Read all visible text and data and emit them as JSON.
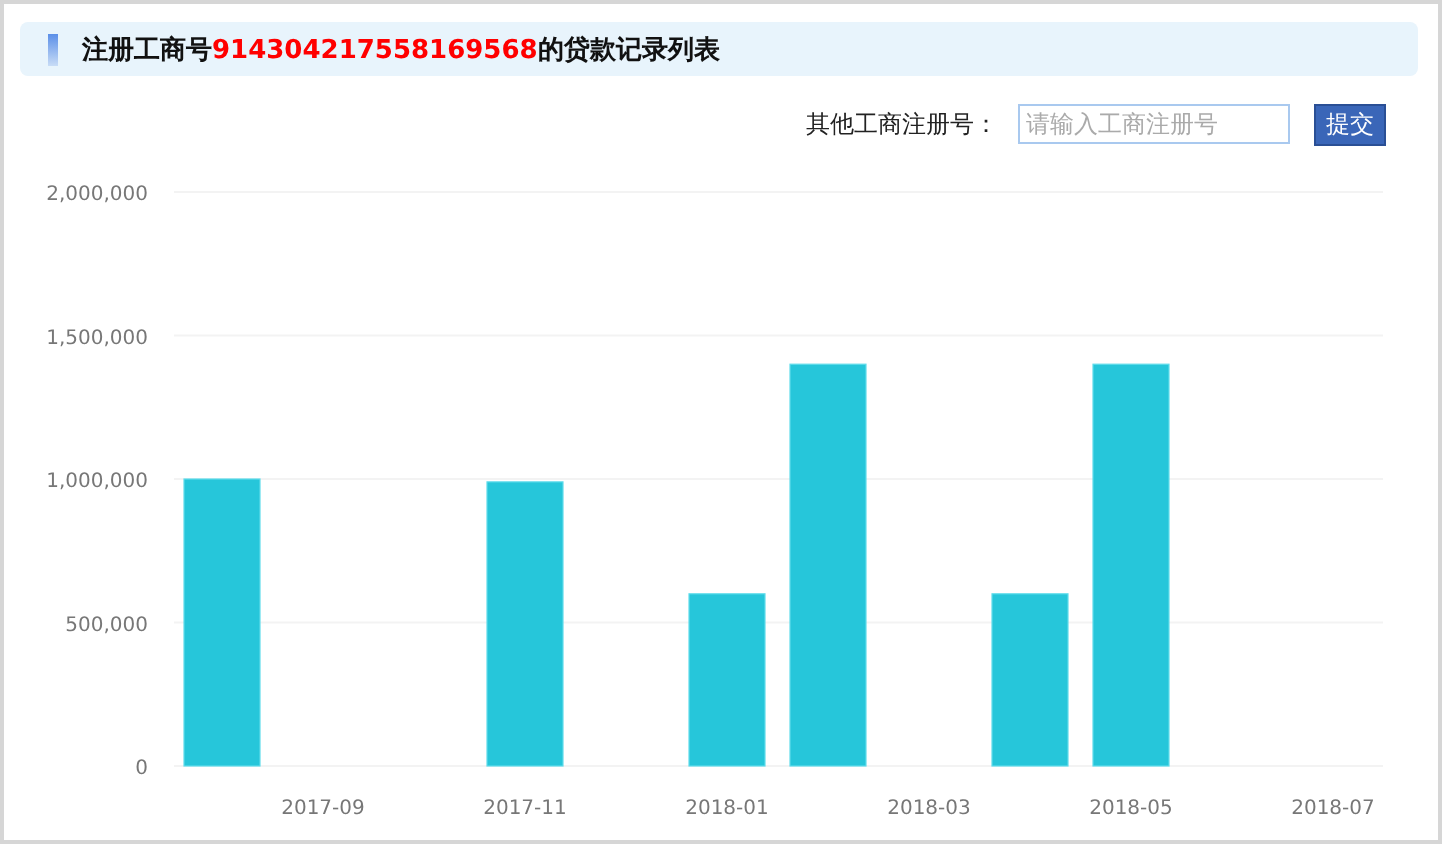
{
  "header": {
    "title": "注册工商号**914304217558169568**的贷款记录列表"
  },
  "search": {
    "label": "其他工商注册号：",
    "placeholder": "请输入工商注册号",
    "button": "提交"
  },
  "chart_data": {
    "type": "bar",
    "grid": true,
    "categories": [
      null,
      "2017-09",
      null,
      "2017-11",
      null,
      "2018-01",
      null,
      "2018-03",
      null,
      "2018-05",
      null,
      "2018-07"
    ],
    "series": [
      {
        "color": "#26c6da",
        "values": [
          1000000,
          null,
          null,
          990000,
          null,
          600000,
          1400000,
          null,
          600000,
          1400000,
          null,
          null
        ]
      }
    ],
    "ylim": [
      0,
      2000000
    ],
    "yticks": [
      {
        "value": 0,
        "label": "0"
      },
      {
        "value": 500000,
        "label": "500,000"
      },
      {
        "value": 1000000,
        "label": "1,000,000"
      },
      {
        "value": 1500000,
        "label": "1,500,000"
      },
      {
        "value": 2000000,
        "label": "2,000,000"
      }
    ]
  }
}
